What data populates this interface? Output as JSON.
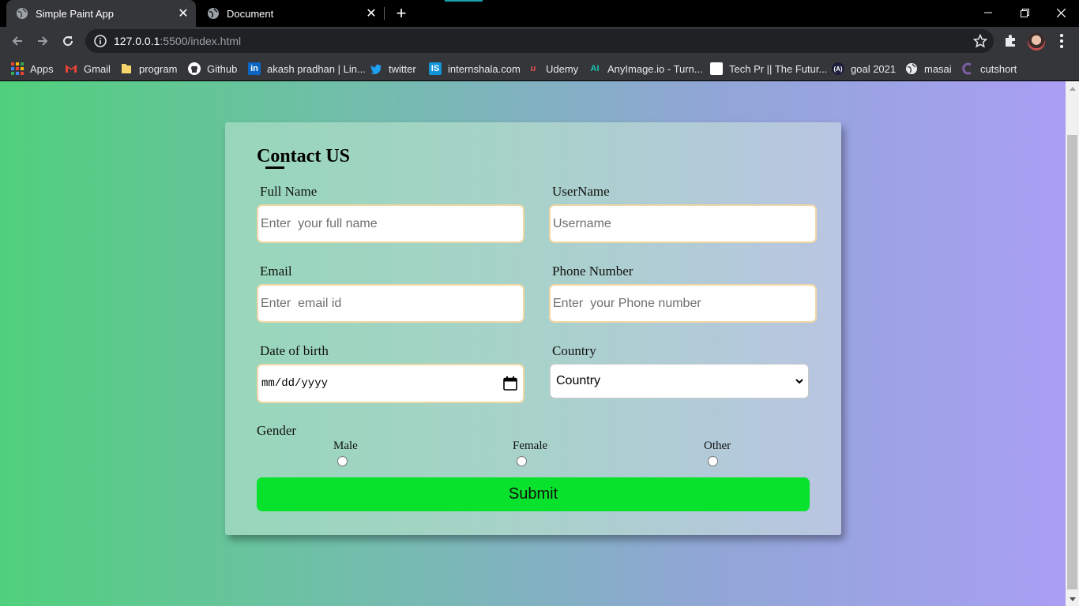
{
  "browser": {
    "tabs": [
      {
        "title": "Simple Paint App",
        "active": true
      },
      {
        "title": "Document",
        "active": false
      }
    ],
    "url_host": "127.0.0.1",
    "url_path": ":5500/index.html",
    "bookmarks": [
      {
        "label": "Apps",
        "icon": "apps-grid-icon"
      },
      {
        "label": "Gmail",
        "icon": "gmail-icon"
      },
      {
        "label": "program",
        "icon": "folder-icon"
      },
      {
        "label": "Github",
        "icon": "github-icon"
      },
      {
        "label": "akash pradhan | Lin...",
        "icon": "linkedin-icon"
      },
      {
        "label": "twitter",
        "icon": "twitter-icon"
      },
      {
        "label": "internshala.com",
        "icon": "internshala-icon"
      },
      {
        "label": "Udemy",
        "icon": "udemy-icon"
      },
      {
        "label": "AnyImage.io - Turn...",
        "icon": "anyimage-icon"
      },
      {
        "label": "Tech Pr || The Futur...",
        "icon": "page-icon"
      },
      {
        "label": "goal 2021",
        "icon": "goal-icon"
      },
      {
        "label": "masai",
        "icon": "globe-icon"
      },
      {
        "label": "cutshort",
        "icon": "cutshort-icon"
      }
    ]
  },
  "form": {
    "title": "Contact US",
    "full_name": {
      "label": "Full Name",
      "placeholder": "Enter  your full name"
    },
    "username": {
      "label": "UserName",
      "placeholder": "Username"
    },
    "email": {
      "label": "Email",
      "placeholder": "Enter  email id"
    },
    "phone": {
      "label": "Phone Number",
      "placeholder": "Enter  your Phone number"
    },
    "dob": {
      "label": "Date of birth",
      "value": "mm/dd/yyyy"
    },
    "country": {
      "label": "Country",
      "selected": "Country"
    },
    "gender": {
      "label": "Gender",
      "options": [
        "Male",
        "Female",
        "Other"
      ]
    },
    "submit_label": "Submit"
  },
  "colors": {
    "submit": "#08e22c",
    "input_border": "#f1d7a4",
    "gradient_left": "#50d07c",
    "gradient_right": "#a99ef4"
  }
}
